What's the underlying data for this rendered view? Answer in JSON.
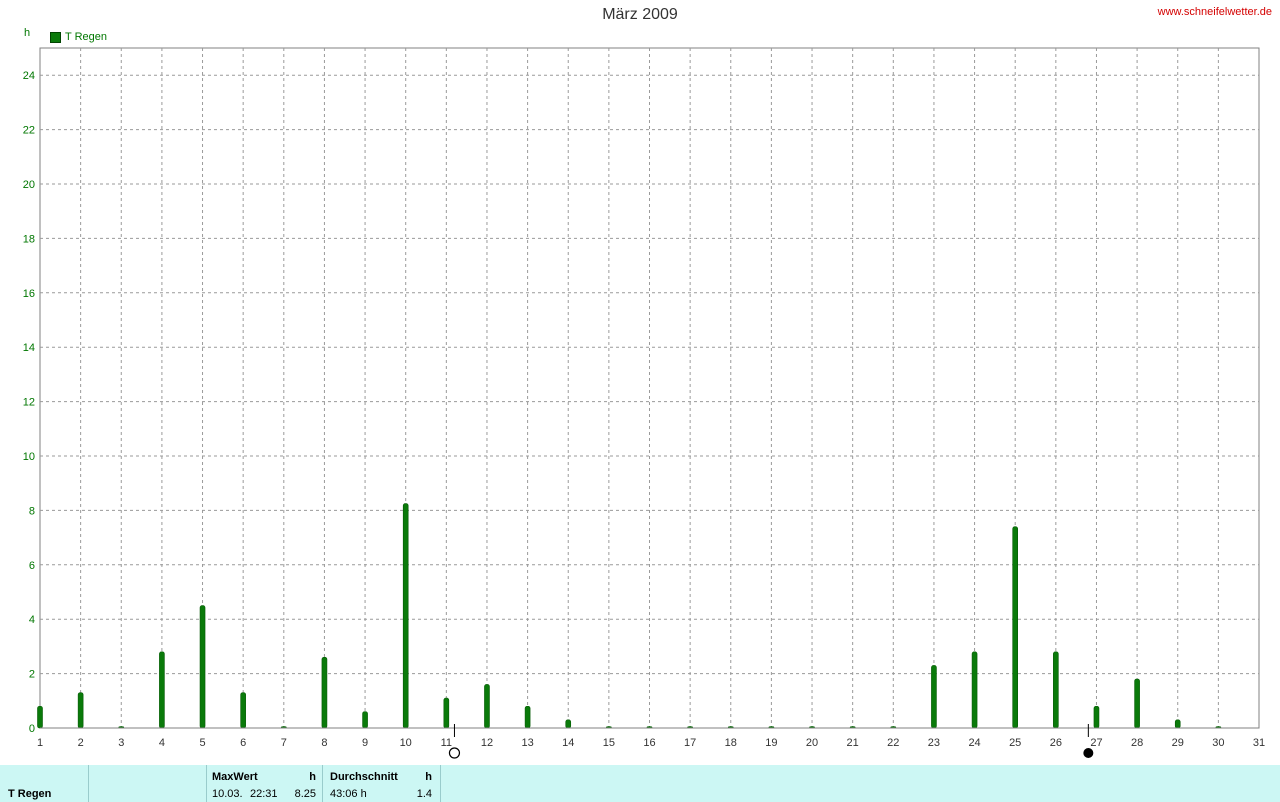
{
  "title": "März 2009",
  "site": "www.schneifelwetter.de",
  "unit": "h",
  "legend": {
    "label": "T Regen",
    "color": "#0a7a0a"
  },
  "stats": {
    "series_name": "T Regen",
    "max_header": "MaxWert",
    "max_unit": "h",
    "max_date": "10.03.",
    "max_time": "22:31",
    "max_value": "8.25",
    "avg_header": "Durchschnitt",
    "avg_unit": "h",
    "avg_total": "43:06 h",
    "avg_value": "1.4"
  },
  "moon_phases": [
    {
      "day": 11.2,
      "phase": "full"
    },
    {
      "day": 26.8,
      "phase": "new"
    }
  ],
  "chart_data": {
    "type": "bar",
    "title": "März 2009",
    "ylabel": "h",
    "xlim": [
      1,
      31
    ],
    "ylim": [
      0,
      25
    ],
    "x_ticks": [
      1,
      2,
      3,
      4,
      5,
      6,
      7,
      8,
      9,
      10,
      11,
      12,
      13,
      14,
      15,
      16,
      17,
      18,
      19,
      20,
      21,
      22,
      23,
      24,
      25,
      26,
      27,
      28,
      29,
      30,
      31
    ],
    "y_ticks": [
      0,
      2,
      4,
      6,
      8,
      10,
      12,
      14,
      16,
      18,
      20,
      22,
      24
    ],
    "grid": true,
    "series": [
      {
        "name": "T Regen",
        "color": "#0a7a0a",
        "x": [
          1,
          2,
          3,
          4,
          5,
          6,
          7,
          8,
          9,
          10,
          11,
          12,
          13,
          14,
          15,
          16,
          17,
          18,
          19,
          20,
          21,
          22,
          23,
          24,
          25,
          26,
          27,
          28,
          29,
          30
        ],
        "values": [
          0.8,
          1.3,
          0,
          2.8,
          4.5,
          1.3,
          0,
          2.6,
          0.6,
          8.25,
          1.1,
          1.6,
          0.8,
          0.3,
          0,
          0,
          0,
          0,
          0,
          0,
          0,
          0,
          2.3,
          2.8,
          7.4,
          2.8,
          0.8,
          1.8,
          0.3,
          0
        ]
      }
    ]
  }
}
